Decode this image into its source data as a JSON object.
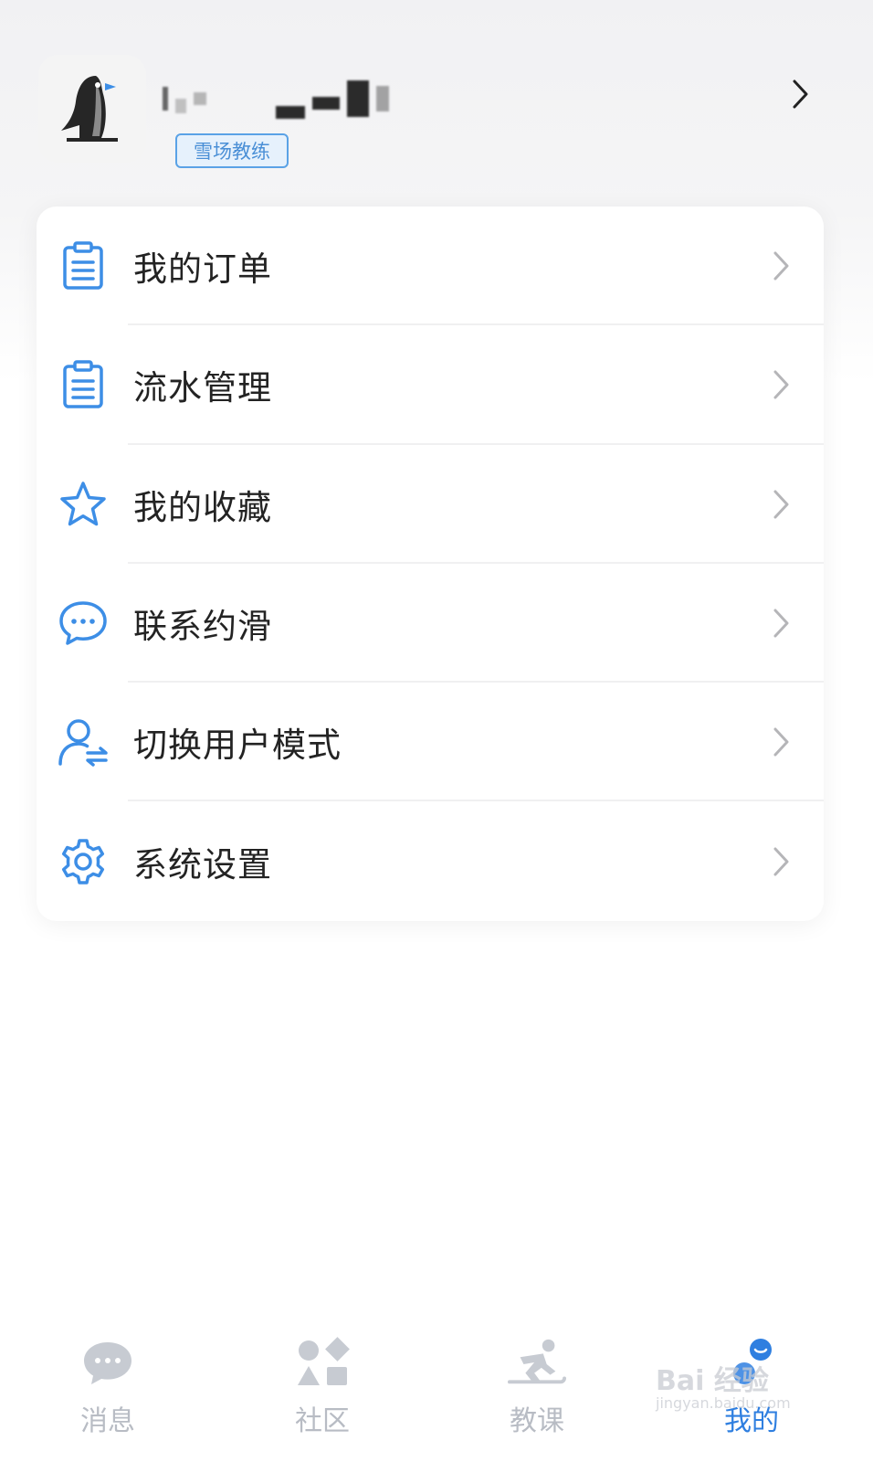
{
  "profile": {
    "role_badge": "雪场教练"
  },
  "menu": {
    "items": [
      {
        "label": "我的订单",
        "icon": "clipboard-icon"
      },
      {
        "label": "流水管理",
        "icon": "clipboard-icon"
      },
      {
        "label": "我的收藏",
        "icon": "star-icon"
      },
      {
        "label": "联系约滑",
        "icon": "chat-bubble-icon"
      },
      {
        "label": "切换用户模式",
        "icon": "switch-user-icon"
      },
      {
        "label": "系统设置",
        "icon": "gear-icon"
      }
    ]
  },
  "tabbar": {
    "tabs": [
      {
        "label": "消息",
        "icon": "message-icon",
        "active": false
      },
      {
        "label": "社区",
        "icon": "community-icon",
        "active": false
      },
      {
        "label": "教课",
        "icon": "ski-lesson-icon",
        "active": false
      },
      {
        "label": "我的",
        "icon": "profile-icon",
        "active": true
      }
    ]
  },
  "watermark": {
    "brand": "Bai 经验",
    "url": "jingyan.baidu.com"
  },
  "colors": {
    "accent": "#2f7fe0",
    "icon_blue": "#3d8ee6",
    "badge_bg": "#e6f1fc",
    "tab_inactive": "#b8bcc4"
  }
}
